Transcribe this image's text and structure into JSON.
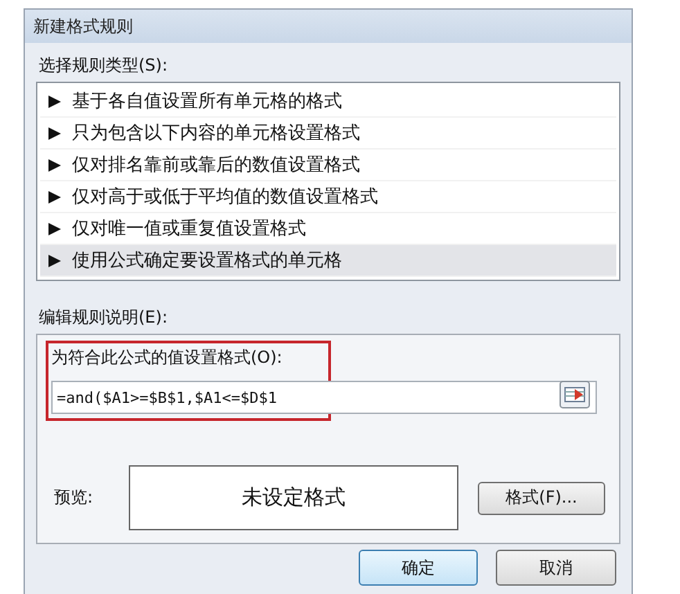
{
  "window": {
    "title": "新建格式规则"
  },
  "rule_type": {
    "label": "选择规则类型(S):",
    "items": [
      {
        "label": "基于各自值设置所有单元格的格式",
        "selected": false
      },
      {
        "label": "只为包含以下内容的单元格设置格式",
        "selected": false
      },
      {
        "label": "仅对排名靠前或靠后的数值设置格式",
        "selected": false
      },
      {
        "label": "仅对高于或低于平均值的数值设置格式",
        "selected": false
      },
      {
        "label": "仅对唯一值或重复值设置格式",
        "selected": false
      },
      {
        "label": "使用公式确定要设置格式的单元格",
        "selected": true
      }
    ]
  },
  "description": {
    "label": "编辑规则说明(E):",
    "formula_label": "为符合此公式的值设置格式(O):",
    "formula": "=and($A1>=$B$1,$A1<=$D$1",
    "preview_label": "预览:",
    "preview_text": "未设定格式",
    "format_button": "格式(F)..."
  },
  "buttons": [
    "确定",
    "取消"
  ]
}
